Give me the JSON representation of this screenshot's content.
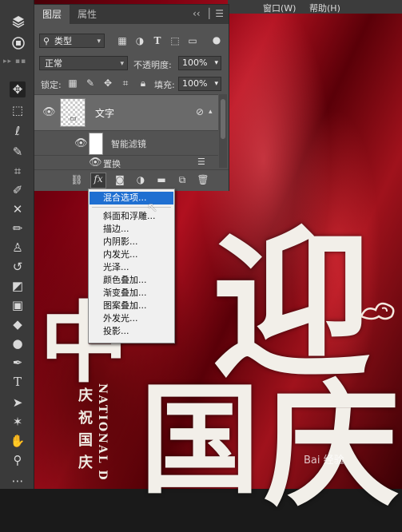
{
  "menubar": {
    "item_window": "窗口(W)",
    "item_help": "帮助(H)"
  },
  "panel": {
    "tab_layers": "图层",
    "tab_properties": "属性",
    "filter_kind": "类型",
    "blend_mode": "正常",
    "opacity_label": "不透明度:",
    "opacity_value": "100%",
    "lock_label": "锁定:",
    "fill_label": "填充:",
    "fill_value": "100%",
    "layers": [
      {
        "name": "文字"
      },
      {
        "name": "智能滤镜"
      },
      {
        "name": "置换"
      }
    ]
  },
  "fx_menu": {
    "items": [
      "混合选项...",
      "斜面和浮雕...",
      "描边...",
      "内阴影...",
      "内发光...",
      "光泽...",
      "颜色叠加...",
      "渐变叠加...",
      "图案叠加...",
      "外发光...",
      "投影..."
    ],
    "highlighted": "混合选项..."
  },
  "canvas": {
    "vertical_en": "NATIONAL D",
    "vertical_cn": "庆祝国庆",
    "big_chars": [
      "迎",
      "国",
      "庆",
      "中"
    ],
    "watermark": "Bai 经验"
  },
  "colors": {
    "panel_bg": "#535353",
    "menu_highlight": "#1f6fd1",
    "canvas_red": "#b0101f"
  }
}
